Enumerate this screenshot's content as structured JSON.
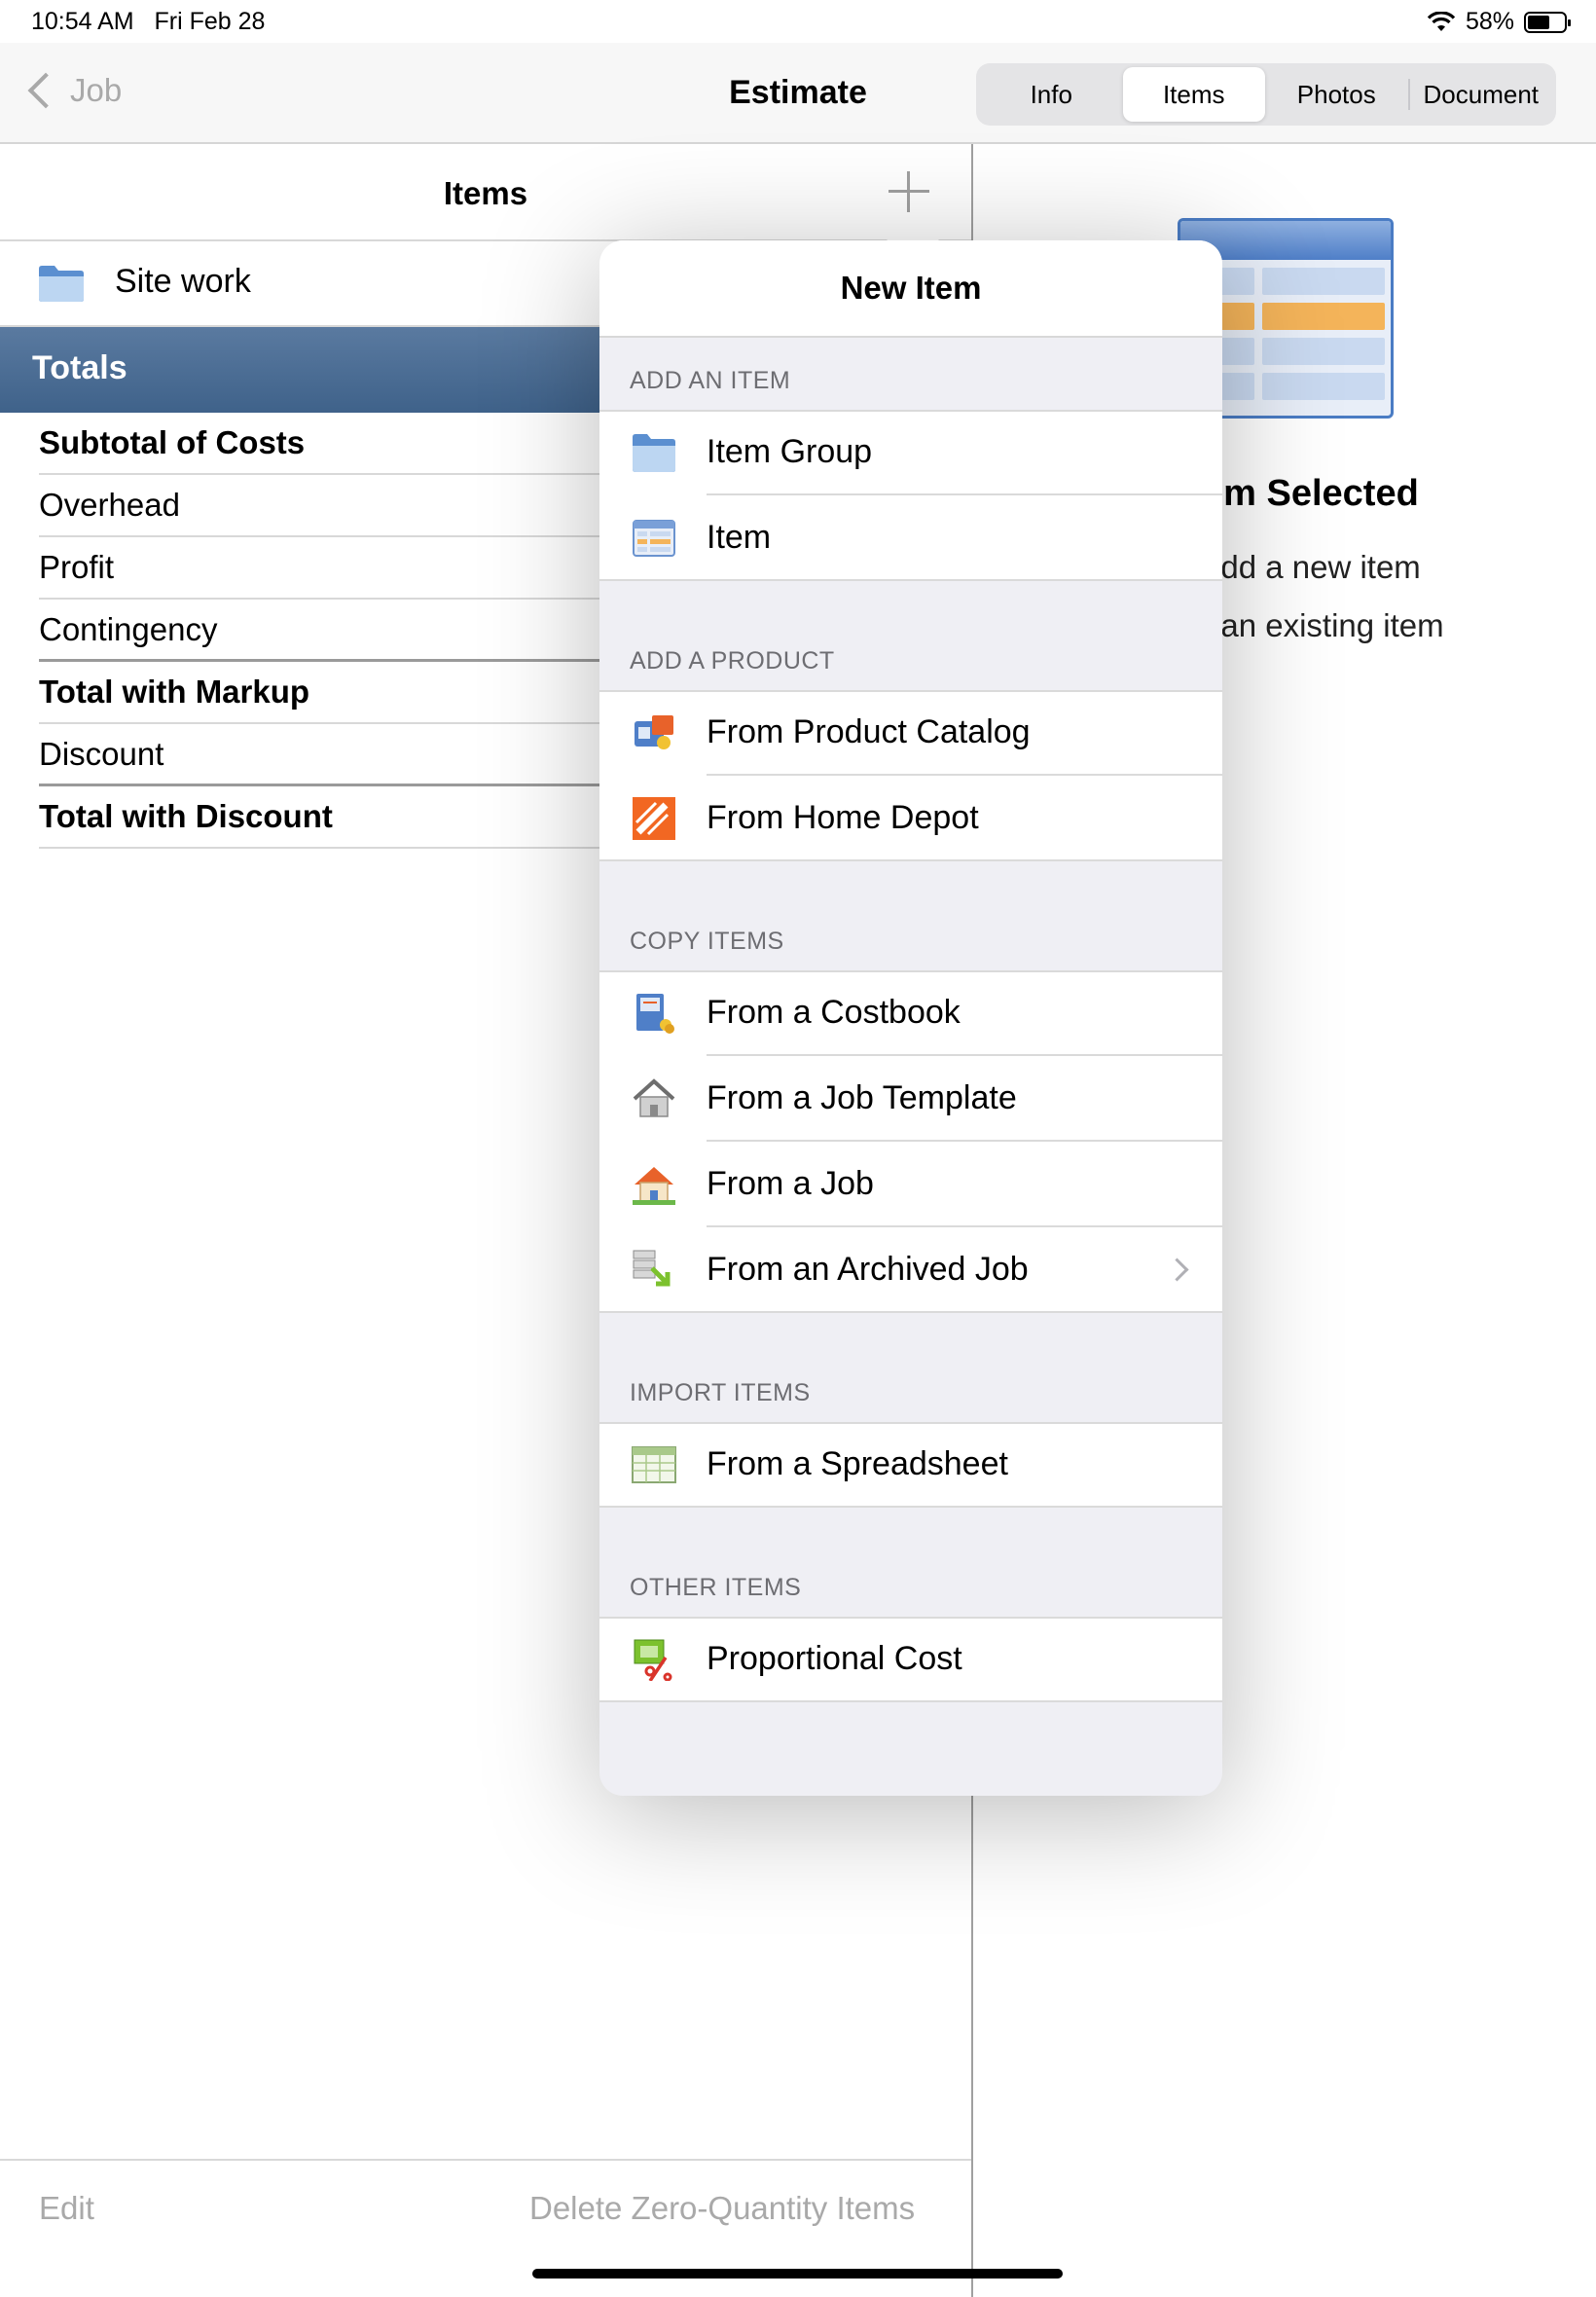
{
  "status_bar": {
    "time": "10:54 AM",
    "date": "Fri Feb 28",
    "battery": "58%",
    "battery_level": 0.58
  },
  "nav": {
    "back_label": "Job",
    "title": "Estimate",
    "tabs": [
      {
        "label": "Info",
        "active": false
      },
      {
        "label": "Items",
        "active": true
      },
      {
        "label": "Photos",
        "active": false
      },
      {
        "label": "Document",
        "active": false
      }
    ]
  },
  "left": {
    "header": "Items",
    "groups": [
      {
        "label": "Site work",
        "icon": "folder-icon"
      }
    ],
    "totals_header": "Totals",
    "totals": [
      {
        "label": "Subtotal of Costs",
        "bold": true
      },
      {
        "label": "Overhead",
        "bold": false
      },
      {
        "label": "Profit",
        "bold": false
      },
      {
        "label": "Contingency",
        "bold": false
      },
      {
        "label": "Total with Markup",
        "bold": true
      },
      {
        "label": "Discount",
        "bold": false
      },
      {
        "label": "Total with Discount",
        "bold": true
      }
    ],
    "edit_label": "Edit",
    "delete_label": "Delete Zero-Quantity Items"
  },
  "right": {
    "title": "em Selected",
    "line1": "add a new item",
    "line2": "t an existing item"
  },
  "popover": {
    "title": "New Item",
    "sections": [
      {
        "header": "ADD AN ITEM",
        "rows": [
          {
            "label": "Item Group",
            "icon": "folder-icon"
          },
          {
            "label": "Item",
            "icon": "item-table-icon"
          }
        ]
      },
      {
        "header": "ADD A PRODUCT",
        "rows": [
          {
            "label": "From Product Catalog",
            "icon": "product-catalog-icon"
          },
          {
            "label": "From Home Depot",
            "icon": "home-depot-icon"
          }
        ]
      },
      {
        "header": "COPY ITEMS",
        "rows": [
          {
            "label": "From a Costbook",
            "icon": "costbook-icon"
          },
          {
            "label": "From a Job Template",
            "icon": "job-template-icon"
          },
          {
            "label": "From a Job",
            "icon": "job-house-icon"
          },
          {
            "label": "From an Archived Job",
            "icon": "archived-job-icon",
            "chevron": true
          }
        ]
      },
      {
        "header": "IMPORT ITEMS",
        "rows": [
          {
            "label": "From a Spreadsheet",
            "icon": "spreadsheet-icon"
          }
        ]
      },
      {
        "header": "OTHER ITEMS",
        "rows": [
          {
            "label": "Proportional Cost",
            "icon": "proportional-cost-icon"
          }
        ]
      }
    ]
  },
  "colors": {
    "totals_bar": "#4a6b93",
    "accent_blue": "#4a7cc4",
    "home_depot_orange": "#f26722"
  }
}
